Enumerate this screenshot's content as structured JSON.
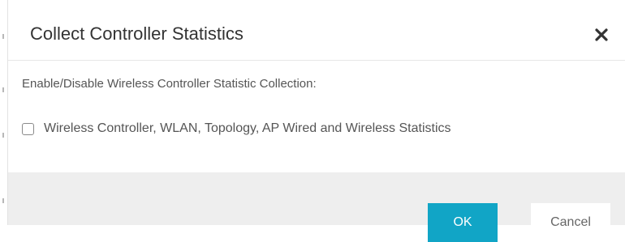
{
  "dialog": {
    "title": "Collect Controller Statistics",
    "close_icon": "close-icon",
    "description": "Enable/Disable Wireless Controller Statistic Collection:",
    "option": {
      "label": "Wireless Controller, WLAN, Topology, AP Wired and Wireless Statistics",
      "checked": false
    },
    "buttons": {
      "ok_label": "OK",
      "cancel_label": "Cancel"
    },
    "colors": {
      "accent": "#11a5c6",
      "footer_bg": "#eeeeee",
      "title_text": "#333333",
      "body_text": "#555555"
    }
  }
}
